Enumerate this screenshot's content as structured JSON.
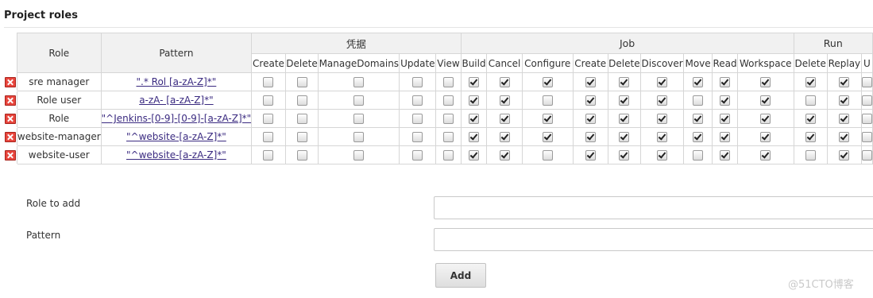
{
  "section": {
    "title": "Project roles"
  },
  "table": {
    "role_header": "Role",
    "pattern_header": "Pattern",
    "groups": [
      {
        "label": "凭据",
        "span": 5
      },
      {
        "label": "Job",
        "span": 9
      },
      {
        "label": "Run",
        "span": 3
      }
    ],
    "perms": [
      "Create",
      "Delete",
      "ManageDomains",
      "Update",
      "View",
      "Build",
      "Cancel",
      "Configure",
      "Create",
      "Delete",
      "Discover",
      "Move",
      "Read",
      "Workspace",
      "Delete",
      "Replay",
      "U"
    ],
    "rows": [
      {
        "role": "sre manager",
        "pattern": "\".* Rol [a-zA-Z]*\"",
        "checks": [
          0,
          0,
          0,
          0,
          0,
          1,
          1,
          1,
          1,
          1,
          1,
          1,
          1,
          1,
          1,
          1,
          0
        ]
      },
      {
        "role": "Role  user",
        "pattern": "a-zA- [a-zA-Z]*\"",
        "checks": [
          0,
          0,
          0,
          0,
          0,
          1,
          1,
          0,
          1,
          1,
          1,
          0,
          1,
          1,
          0,
          1,
          0
        ]
      },
      {
        "role": "Role",
        "pattern": "\"^Jenkins-[0-9]-[0-9]-[a-zA-Z]*\"",
        "checks": [
          0,
          0,
          0,
          0,
          0,
          1,
          1,
          1,
          1,
          1,
          1,
          1,
          1,
          1,
          1,
          1,
          0
        ]
      },
      {
        "role": "website-manager",
        "pattern": "\"^website-[a-zA-Z]*\"",
        "checks": [
          0,
          0,
          0,
          0,
          0,
          1,
          1,
          1,
          1,
          1,
          1,
          1,
          1,
          1,
          1,
          1,
          0
        ]
      },
      {
        "role": "website-user",
        "pattern": "\"^website-[a-zA-Z]*\"",
        "checks": [
          0,
          0,
          0,
          0,
          0,
          1,
          1,
          0,
          1,
          1,
          1,
          0,
          1,
          1,
          0,
          1,
          0
        ]
      }
    ]
  },
  "form": {
    "role_label": "Role to add",
    "role_value": "",
    "pattern_label": "Pattern",
    "pattern_value": "",
    "add_label": "Add"
  },
  "watermark": "@51CTO博客"
}
